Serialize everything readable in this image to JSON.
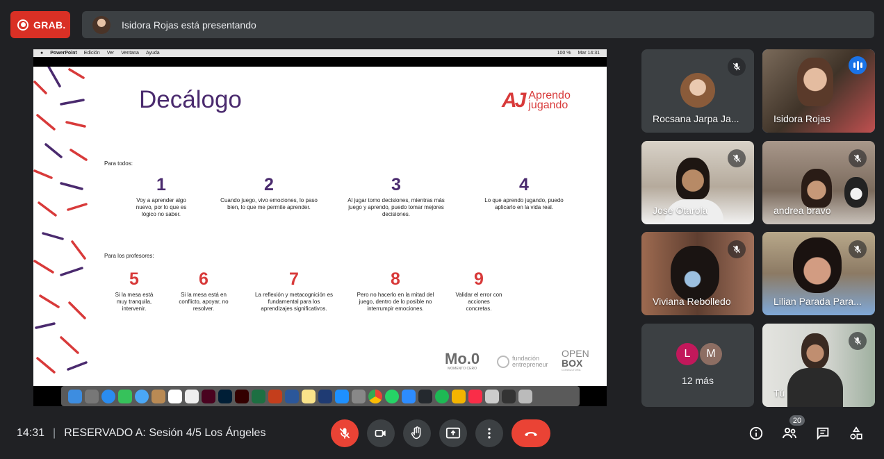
{
  "recording": {
    "label": "GRAB."
  },
  "presenting_bar": {
    "text": "Isidora Rojas está presentando"
  },
  "mac_menu": {
    "app": "PowerPoint",
    "items": [
      "Edición",
      "Ver",
      "Ventana",
      "Ayuda"
    ],
    "battery": "100 %",
    "clock": "Mar 14:31"
  },
  "slide": {
    "title": "Decálogo",
    "brand_line1": "Aprendo",
    "brand_line2": "jugando",
    "section1": "Para todos:",
    "section2": "Para los profesores:",
    "items": [
      {
        "num": "1",
        "text": "Voy a aprender algo nuevo, por lo que es lógico no saber."
      },
      {
        "num": "2",
        "text": "Cuando juego, vivo emociones, lo paso bien, lo que me permite aprender."
      },
      {
        "num": "3",
        "text": "Al jugar tomo decisiones, mientras más juego y aprendo, puedo tomar mejores decisiones."
      },
      {
        "num": "4",
        "text": "Lo que aprendo jugando, puedo aplicarlo en la vida real."
      },
      {
        "num": "5",
        "text": "Si la mesa está muy tranquila, intervenir."
      },
      {
        "num": "6",
        "text": "Si la mesa está en conflicto, apoyar, no resolver."
      },
      {
        "num": "7",
        "text": "La reflexión y metacognición es fundamental para los aprendizajes significativos."
      },
      {
        "num": "8",
        "text": "Pero no hacerlo en la mitad del juego, dentro de lo posible no interrumpir emociones."
      },
      {
        "num": "9",
        "text": "Validar el error con acciones concretas."
      }
    ],
    "logo1": "Mo.0",
    "logo1_sub": "MOMENTO CERO",
    "logo2_line1": "fundación",
    "logo2_line2": "entrepreneur",
    "logo3_line1": "OPEN",
    "logo3_line2": "BOX",
    "logo3_sub": "CONSULTORA"
  },
  "participants": [
    {
      "name": "Rocsana Jarpa Ja..."
    },
    {
      "name": "Isidora Rojas"
    },
    {
      "name": "Jose Otarola"
    },
    {
      "name": "andrea bravo"
    },
    {
      "name": "Viviana Rebolledo"
    },
    {
      "name": "Lilian Parada Para..."
    },
    {
      "name": "Tú"
    }
  ],
  "more": {
    "initial1": "L",
    "initial2": "M",
    "label": "12 más",
    "color1": "#c2185b",
    "color2": "#8d6e63"
  },
  "bottom": {
    "time": "14:31",
    "separator": "|",
    "meeting": "RESERVADO A: Sesión 4/5 Los Ángeles",
    "people_count": "20"
  }
}
